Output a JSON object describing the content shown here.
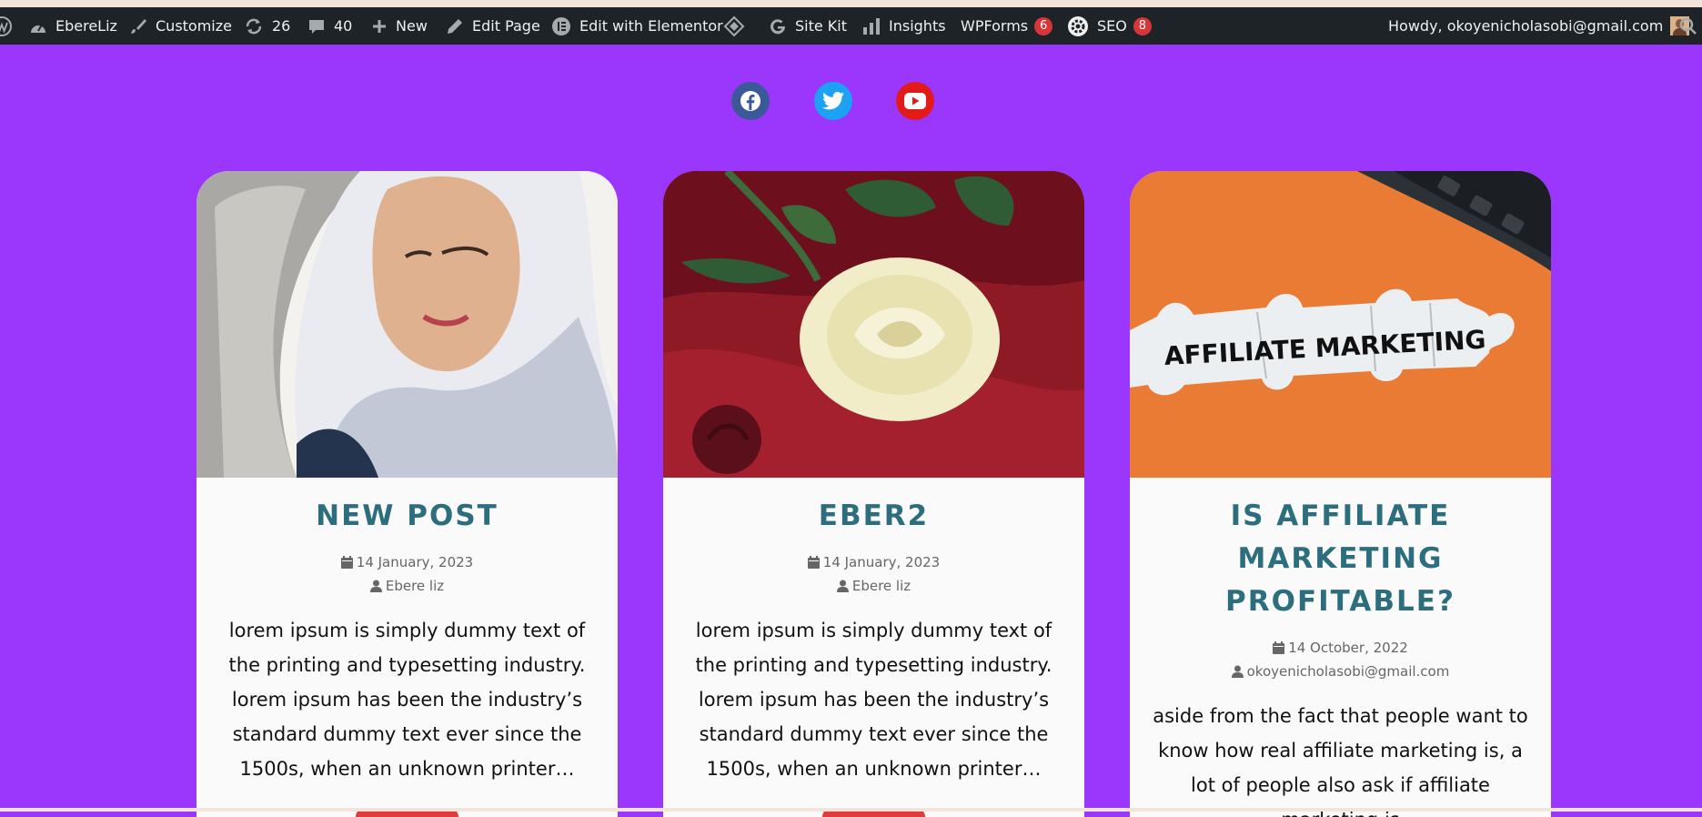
{
  "admin_bar": {
    "site_name": "EbereLiz",
    "customize": "Customize",
    "updates_count": "26",
    "comments_count": "40",
    "new": "New",
    "edit_page": "Edit Page",
    "edit_elementor": "Edit with Elementor",
    "site_kit": "Site Kit",
    "insights": "Insights",
    "wpforms": "WPForms",
    "wpforms_badge": "6",
    "seo": "SEO",
    "seo_badge": "8",
    "howdy": "Howdy, okoyenicholasobi@gmail.com"
  },
  "social": [
    {
      "name": "facebook-icon",
      "color": "#3b5998"
    },
    {
      "name": "twitter-icon",
      "color": "#1da1f2"
    },
    {
      "name": "youtube-icon",
      "color": "#e21a1a"
    }
  ],
  "posts": [
    {
      "title": "NEW POST",
      "date": "14 January, 2023",
      "author": "Ebere liz",
      "excerpt": "lorem ipsum is simply dummy text of the printing and typesetting industry. lorem ipsum has been the industry’s standard dummy text ever since the 1500s, when an unknown printer…"
    },
    {
      "title": "EBER2",
      "date": "14 January, 2023",
      "author": "Ebere liz",
      "excerpt": "lorem ipsum is simply dummy text of the printing and typesetting industry. lorem ipsum has been the industry’s standard dummy text ever since the 1500s, when an unknown printer…"
    },
    {
      "title": "IS AFFILIATE MARKETING PROFITABLE?",
      "date": "14 October, 2022",
      "author": "okoyenicholasobi@gmail.com",
      "excerpt": "aside from the fact that people want to know how real affiliate marketing is, a lot of people also ask if affiliate marketing is",
      "image_text": "AFFILIATE MARKETING"
    }
  ],
  "colors": {
    "background": "#9b37fd",
    "admin_bar": "#1d2327",
    "title": "#2d6e7e",
    "badge": "#d63638",
    "read_more": "#e23b3b"
  }
}
